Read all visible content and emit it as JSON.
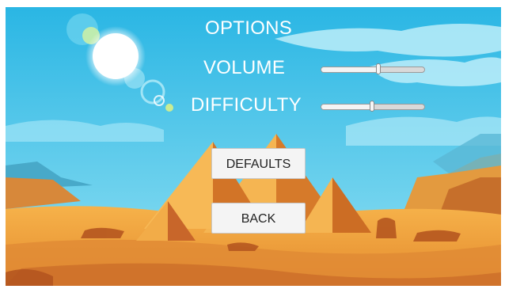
{
  "menu": {
    "title": "OPTIONS",
    "volume_label": "VOLUME",
    "difficulty_label": "DIFFICULTY",
    "defaults_label": "DEFAULTS",
    "back_label": "BACK"
  },
  "settings": {
    "volume": 0.55,
    "difficulty": 0.49
  },
  "colors": {
    "sky": "#39c3e6",
    "text": "#ffffff",
    "button": "#f4f4f4",
    "sand": "#f0a53c"
  },
  "background": {
    "scene": "desert-pyramids",
    "elements": [
      "sun-icon",
      "lens-flare",
      "clouds",
      "pyramids",
      "desert-sand",
      "rocks"
    ]
  }
}
